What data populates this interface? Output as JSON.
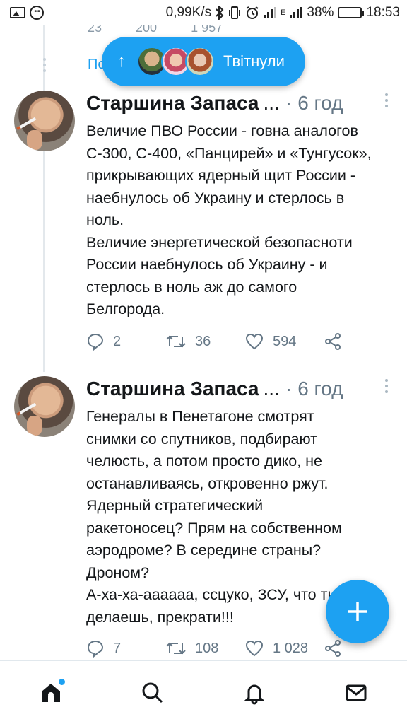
{
  "status_bar": {
    "network_speed": "0,99K/s",
    "battery_percent": "38%",
    "battery_level": 0.38,
    "time": "18:53",
    "network_type": "E",
    "icons": [
      "image-icon",
      "more-circle-icon",
      "bluetooth-icon",
      "vibrate-icon",
      "alarm-icon",
      "signal-icon",
      "battery-icon"
    ]
  },
  "previous_tweet": {
    "reply_count": "23",
    "retweet_count": "200",
    "like_count": "1 957",
    "link_fragment": "По"
  },
  "retweet_pill": {
    "label": "Твітнули",
    "icon": "arrow-up-icon"
  },
  "tweets": [
    {
      "name": "Старшина Запаса",
      "handle": "...",
      "separator": "·",
      "time": "6 год",
      "lines": [
        "Величие ПВО России - говна аналогов",
        "С-300, С-400, «Панцирей» и «Тунгусок»,",
        "прикрывающих ядерный щит России -",
        "наебнулось об Украину и стерлось в",
        "ноль.",
        "Величие энергетической безопасноти",
        "России наебнулось об Украину - и",
        "стерлось в ноль аж до самого",
        "Белгорода."
      ],
      "reply_count": "2",
      "retweet_count": "36",
      "like_count": "594"
    },
    {
      "name": "Старшина Запаса",
      "handle": "...",
      "separator": "·",
      "time": "6 год",
      "lines": [
        "Генералы в Пенетагоне смотрят",
        "снимки со спутников, подбирают",
        "челюсть, а потом просто дико, не",
        "останавливаясь, откровенно ржут.",
        "Ядерный стратегический",
        "ракетоносец? Прям на собственном",
        "аэродроме? В середине страны?",
        "Дроном?",
        "А-ха-ха-аааааа, ссцуко, ЗСУ, что ты",
        "делаешь, прекрати!!!"
      ],
      "reply_count": "7",
      "retweet_count": "108",
      "like_count": "1 028"
    }
  ],
  "fab": {
    "icon": "compose-plus-icon"
  },
  "bottom_nav": {
    "items": [
      "home-icon",
      "search-icon",
      "notifications-icon",
      "messages-icon"
    ]
  },
  "colors": {
    "accent": "#1da1f2",
    "text": "#14171a",
    "muted": "#657786"
  }
}
